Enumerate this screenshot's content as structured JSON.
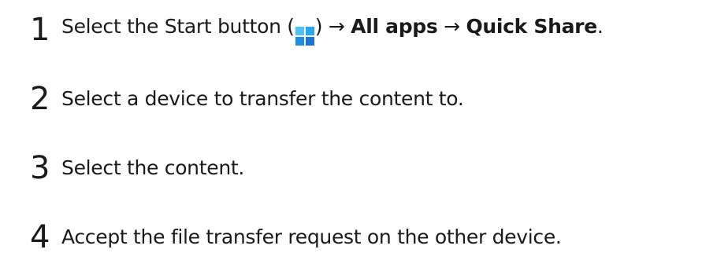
{
  "steps": [
    {
      "number": "1",
      "text_before": "Select the Start button (",
      "text_after_icon": ") → ",
      "bold_1": "All apps",
      "arrow": " → ",
      "bold_2": "Quick Share",
      "end": ".",
      "icon": "windows-start-icon"
    },
    {
      "number": "2",
      "text": "Select a device to transfer the content to."
    },
    {
      "number": "3",
      "text": "Select the content."
    },
    {
      "number": "4",
      "text": "Accept the file transfer request on the other device."
    }
  ]
}
